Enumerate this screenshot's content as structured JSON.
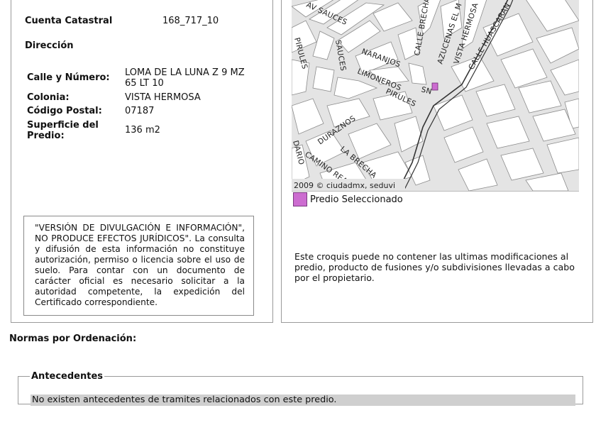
{
  "predio": {
    "cuenta_catastral_label": "Cuenta Catastral",
    "cuenta_catastral_value": "168_717_10",
    "direccion_label": "Dirección",
    "calle_label": "Calle y Número:",
    "calle_value_line1": "LOMA DE LA LUNA Z 9 MZ",
    "calle_value_line2": "65 LT 10",
    "colonia_label": "Colonia:",
    "colonia_value": "VISTA HERMOSA",
    "cp_label": "Código Postal:",
    "cp_value": "07187",
    "superficie_label_line1": "Superficie del",
    "superficie_label_line2": "Predio:",
    "superficie_value": "136 m2"
  },
  "notice": {
    "text": "\"VERSIÓN DE DIVULGACIÓN E INFORMACIÓN\", NO PRODUCE EFECTOS JURÍDICOS\". La consulta y difusión de esta información no constituye autorización, permiso o licencia sobre el uso de suelo. Para contar con un documento de carácter oficial es necesario solicitar a la autoridad competente, la expedición del Certificado correspondiente."
  },
  "map": {
    "streets": [
      "AV SAUCES",
      "PIRULES",
      "SAUCES",
      "NARANJOS",
      "LIMONEROS",
      "CALLE BRECHA",
      "AZUCENAS EL M",
      "VISTA HERMOSA",
      "CALLE HUASCARAN",
      "DURAZNOS",
      "CAMINO REAL",
      "LA BRECHA",
      "DARIO",
      "SN"
    ],
    "copyright": "2009 © ciudadmx, seduvi",
    "legend_label": "Predio Seleccionado",
    "legend_color": "#cc6cd0",
    "note": "Este croquis puede no contener las ultimas modificaciones al predio, producto de fusiones y/o subdivisiones llevadas a cabo por el propietario."
  },
  "normas": {
    "title": "Normas por Ordenación:"
  },
  "antecedentes": {
    "title": "Antecedentes",
    "message": "No existen antecedentes de tramites relacionados con este predio."
  }
}
